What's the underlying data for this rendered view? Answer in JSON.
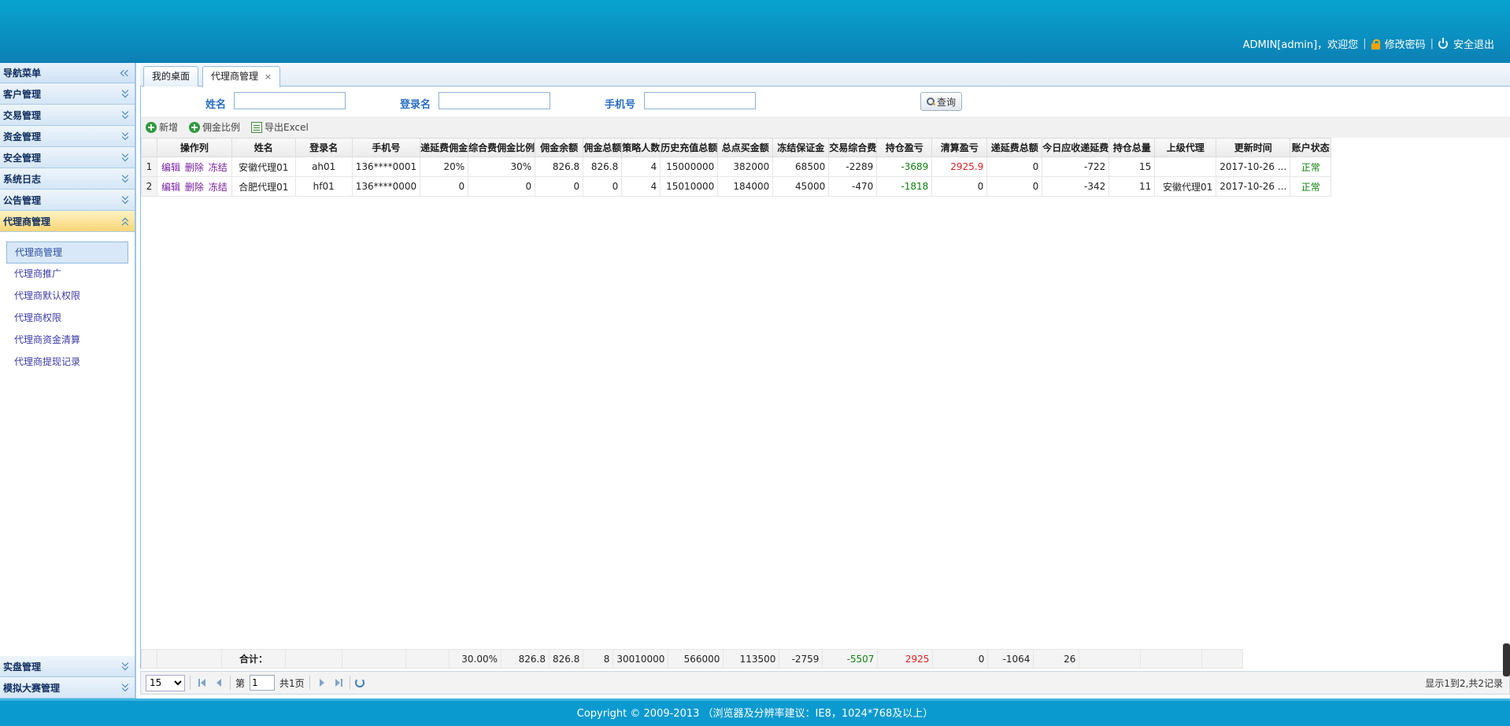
{
  "header": {
    "user": "ADMIN[admin]，欢迎您",
    "change_password": "修改密码",
    "logout": "安全退出"
  },
  "sidebar": {
    "title": "导航菜单",
    "groups": [
      {
        "label": "客户管理"
      },
      {
        "label": "交易管理"
      },
      {
        "label": "资金管理"
      },
      {
        "label": "安全管理"
      },
      {
        "label": "系统日志"
      },
      {
        "label": "公告管理"
      },
      {
        "label": "代理商管理"
      }
    ],
    "sub_items": [
      {
        "label": "代理商管理"
      },
      {
        "label": "代理商推广"
      },
      {
        "label": "代理商默认权限"
      },
      {
        "label": "代理商权限"
      },
      {
        "label": "代理商资金清算"
      },
      {
        "label": "代理商提现记录"
      }
    ],
    "bottom_groups": [
      {
        "label": "实盘管理"
      },
      {
        "label": "模拟大赛管理"
      }
    ]
  },
  "tabs": [
    {
      "label": "我的桌面"
    },
    {
      "label": "代理商管理",
      "close": "×"
    }
  ],
  "search": {
    "name_label": "姓名",
    "login_label": "登录名",
    "phone_label": "手机号",
    "query_button": "查询"
  },
  "toolbar": {
    "add": "新增",
    "commission_ratio": "佣金比例",
    "export": "导出Excel"
  },
  "table": {
    "headers": [
      "操作列",
      "姓名",
      "登录名",
      "手机号",
      "递延费佣金",
      "综合费佣金比例",
      "佣金余额",
      "佣金总额",
      "策略人数",
      "历史充值总额",
      "总点买金额",
      "冻结保证金",
      "交易综合费",
      "持仓盈亏",
      "清算盈亏",
      "递延费总额",
      "今日应收递延费",
      "持仓总量",
      "上级代理",
      "更新时间",
      "账户状态"
    ],
    "actions": [
      "编辑",
      "删除",
      "冻结"
    ],
    "rows": [
      {
        "rn": "1",
        "name": "安徽代理01",
        "login": "ah01",
        "phone": "136****0001",
        "deferral_comm": "20%",
        "comp_comm": "30%",
        "comm_balance": "826.8",
        "comm_total": "826.8",
        "strategies": "4",
        "recharge": "15000000",
        "buy_total": "382000",
        "frozen": "68500",
        "trade_fee": "-2289",
        "pos_pl": "-3689",
        "settle_pl": "2925.9",
        "deferral_total": "0",
        "today_deferral": "-722",
        "pos_qty": "15",
        "parent": "",
        "updated": "2017-10-26 ...",
        "status": "正常"
      },
      {
        "rn": "2",
        "name": "合肥代理01",
        "login": "hf01",
        "phone": "136****0000",
        "deferral_comm": "0",
        "comp_comm": "0",
        "comm_balance": "0",
        "comm_total": "0",
        "strategies": "4",
        "recharge": "15010000",
        "buy_total": "184000",
        "frozen": "45000",
        "trade_fee": "-470",
        "pos_pl": "-1818",
        "settle_pl": "0",
        "deferral_total": "0",
        "today_deferral": "-342",
        "pos_qty": "11",
        "parent": "安徽代理01",
        "updated": "2017-10-26 ...",
        "status": "正常"
      }
    ],
    "footer": {
      "label": "合计：",
      "comp_comm": "30.00%",
      "comm_balance": "826.8",
      "comm_total": "826.8",
      "strategies": "8",
      "recharge": "30010000",
      "buy_total": "566000",
      "frozen": "113500",
      "trade_fee": "-2759",
      "pos_pl": "-5507",
      "settle_pl": "2925",
      "deferral_total": "0",
      "today_deferral": "-1064",
      "pos_qty": "26"
    }
  },
  "pager": {
    "page_size": "15",
    "page_prefix": "第",
    "page_value": "1",
    "page_suffix": "共1页",
    "info": "显示1到2,共2记录"
  },
  "footer": {
    "copyright": "Copyright © 2009-2013 （浏览器及分辨率建议：IE8，1024*768及以上）"
  },
  "colors": {
    "header_bg": "#0a8fc0",
    "positive_green": "#108010",
    "negative_red": "#e02020",
    "active_group": "#fcd676"
  }
}
